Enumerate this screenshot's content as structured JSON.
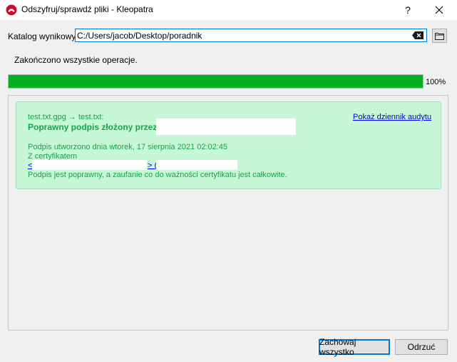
{
  "window": {
    "title": "Odszyfruj/sprawdź pliki - Kleopatra",
    "help_label": "?",
    "app_icon": "kleopatra-icon",
    "close_icon": "close-icon"
  },
  "output_dir": {
    "label": "Katalog wynikowy:",
    "value": "C:/Users/jacob/Desktop/poradnik",
    "clear_icon": "clear-input-icon",
    "browse_icon": "folder-icon"
  },
  "status": "Zakończono wszystkie operacje.",
  "progress": {
    "value_percent": 100,
    "label": "100%",
    "color": "#06b025"
  },
  "result": {
    "files": "test.txt.gpg → test.txt:",
    "signature_heading": "Poprawny podpis złożony przez",
    "audit_log_link": "Pokaż dziennik audytu",
    "created": "Podpis utworzono dnia wtorek, 17 sierpnia 2021 02:02:45",
    "with_certificate": "Z certyfikatem",
    "cert_open": "<",
    "cert_close": "> (",
    "validity": "Podpis jest poprawny, a zaufanie co do ważności certyfikatu jest całkowite.",
    "background_color": "#c6f7d6",
    "text_color": "#19a34a"
  },
  "buttons": {
    "keep_all": "Zachowaj wszystko",
    "discard": "Odrzuć"
  }
}
